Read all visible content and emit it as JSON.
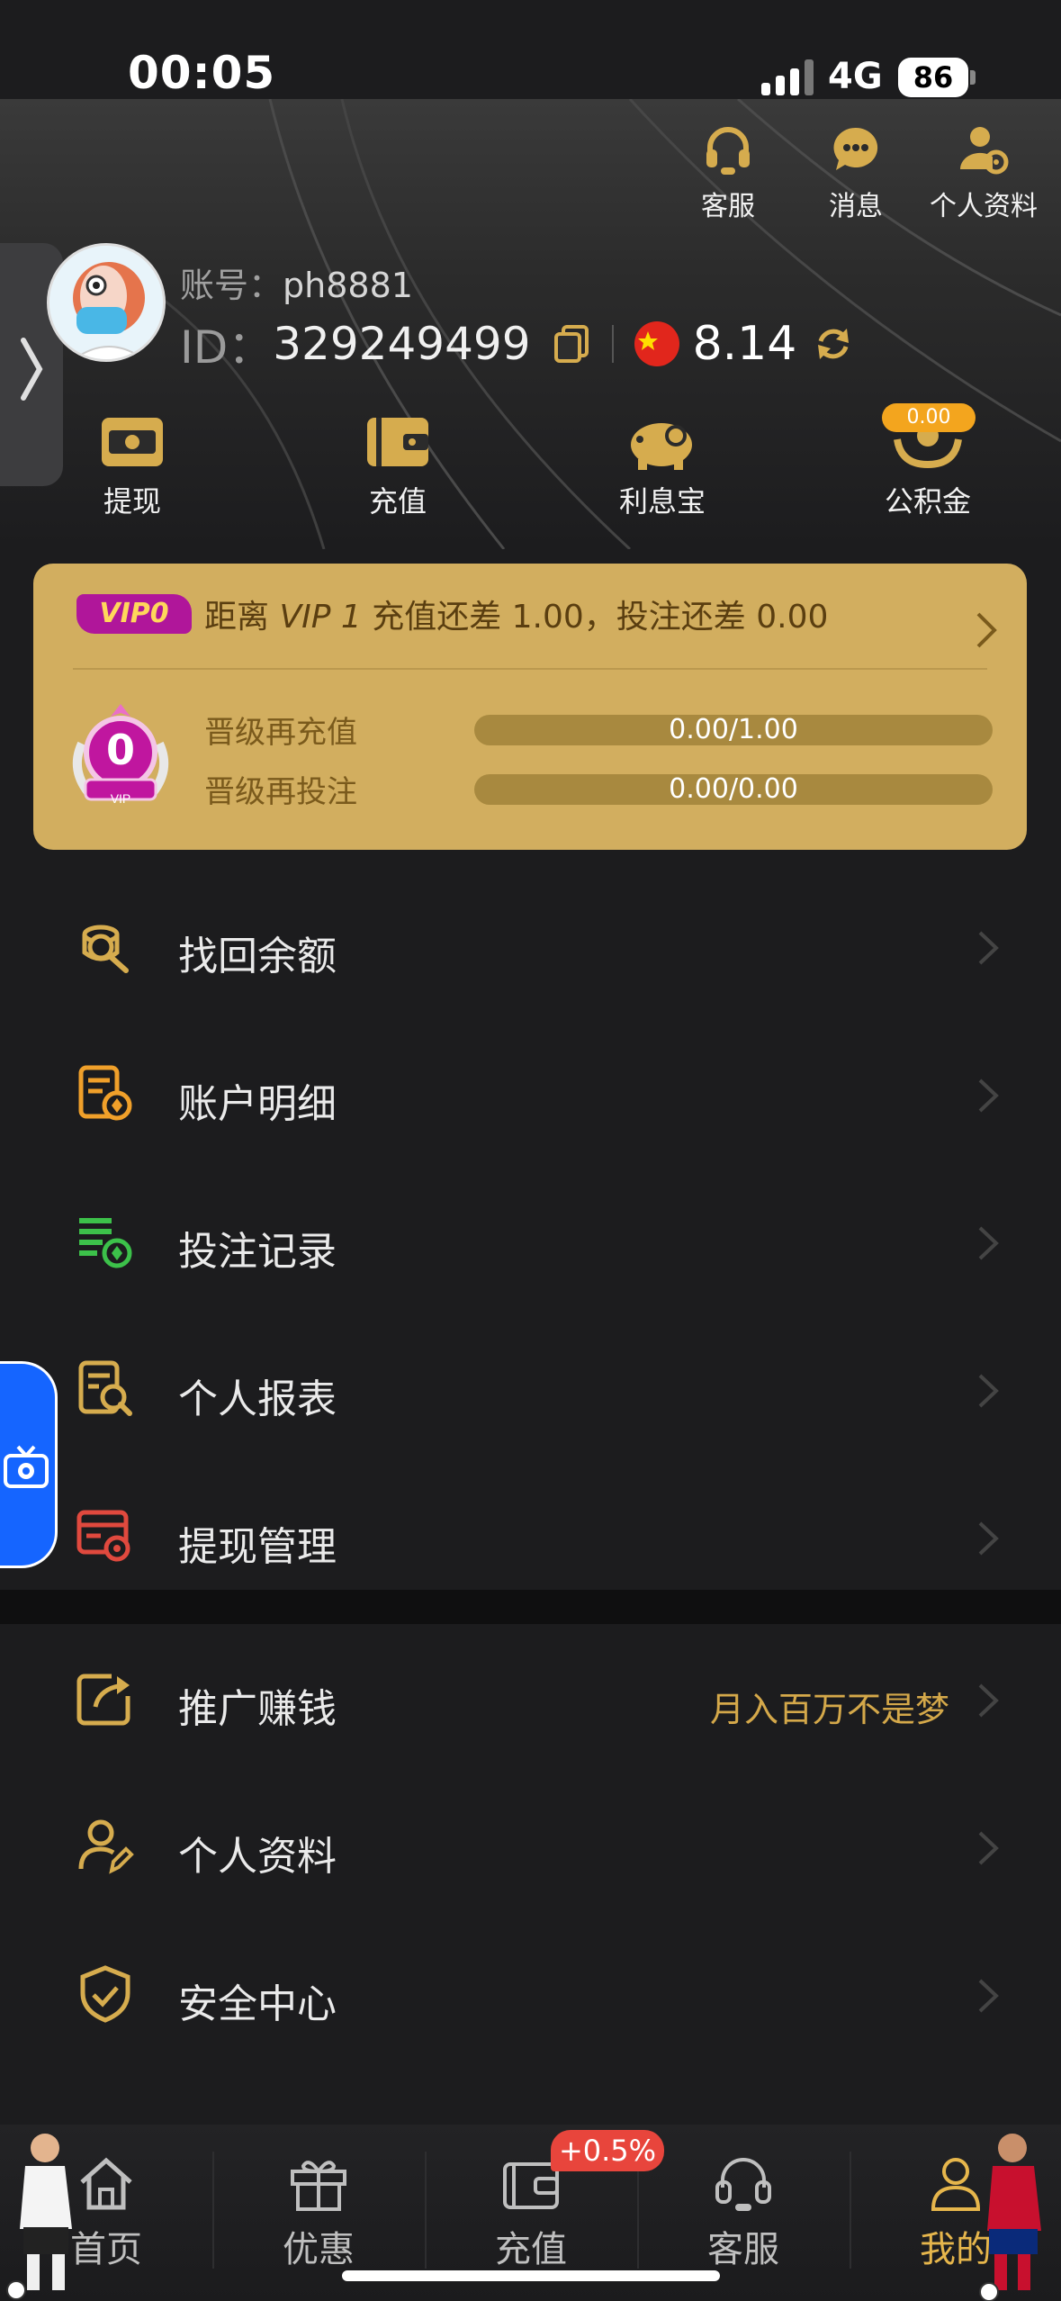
{
  "status_bar": {
    "time": "00:05",
    "network": "4G",
    "battery": "86"
  },
  "header": {
    "top_icons": [
      {
        "label": "客服",
        "icon": "headset-icon"
      },
      {
        "label": "消息",
        "icon": "message-icon"
      },
      {
        "label": "个人资料",
        "icon": "profile-settings-icon"
      }
    ],
    "account_label": "账号：",
    "account": "ph8881",
    "id_label": "ID：",
    "id": "329249499",
    "balance": "8.14",
    "quick_actions": [
      {
        "label": "提现",
        "icon": "withdraw-icon"
      },
      {
        "label": "充值",
        "icon": "wallet-icon"
      },
      {
        "label": "利息宝",
        "icon": "piggy-bank-icon"
      },
      {
        "label": "公积金",
        "icon": "hands-coin-icon"
      }
    ],
    "fund_badge": "0.00"
  },
  "vip": {
    "tag": "VIP0",
    "title_prefix": "距离 ",
    "title_level": "VIP 1",
    "title_suffix": " 充值还差 1.00，投注还差 0.00",
    "level_number": "0",
    "medal_text": "VIP",
    "rows": [
      {
        "label": "晋级再充值",
        "progress": "0.00/1.00",
        "fraction": 0.0
      },
      {
        "label": "晋级再投注",
        "progress": "0.00/0.00",
        "fraction": 0.0
      }
    ]
  },
  "menu": [
    {
      "label": "找回余额",
      "icon": "coins-search-icon",
      "color": "#d6ac4e"
    },
    {
      "label": "账户明细",
      "icon": "account-detail-icon",
      "color": "#f0a02a"
    },
    {
      "label": "投注记录",
      "icon": "bet-record-icon",
      "color": "#3cc14a"
    },
    {
      "label": "个人报表",
      "icon": "report-search-icon",
      "color": "#d6ac4e"
    },
    {
      "label": "提现管理",
      "icon": "withdraw-manage-icon",
      "color": "#e0493e"
    }
  ],
  "menu2": [
    {
      "label": "推广赚钱",
      "icon": "share-icon",
      "extra": "月入百万不是梦",
      "color": "#d6ac4e"
    },
    {
      "label": "个人资料",
      "icon": "user-edit-icon",
      "extra": "",
      "color": "#d6ac4e"
    },
    {
      "label": "安全中心",
      "icon": "shield-check-icon",
      "extra": "",
      "color": "#d6ac4e"
    }
  ],
  "bottom_nav": {
    "items": [
      {
        "label": "首页",
        "icon": "home-icon"
      },
      {
        "label": "优惠",
        "icon": "gift-icon"
      },
      {
        "label": "充值",
        "icon": "wallet-icon"
      },
      {
        "label": "客服",
        "icon": "headset-icon"
      },
      {
        "label": "我的",
        "icon": "user-icon"
      }
    ],
    "active": "我的",
    "promo_badge": "+0.5%"
  },
  "colors": {
    "accent": "#d6ac4e",
    "vip_card": "#d2ae5f",
    "background": "#1c1c1e"
  }
}
